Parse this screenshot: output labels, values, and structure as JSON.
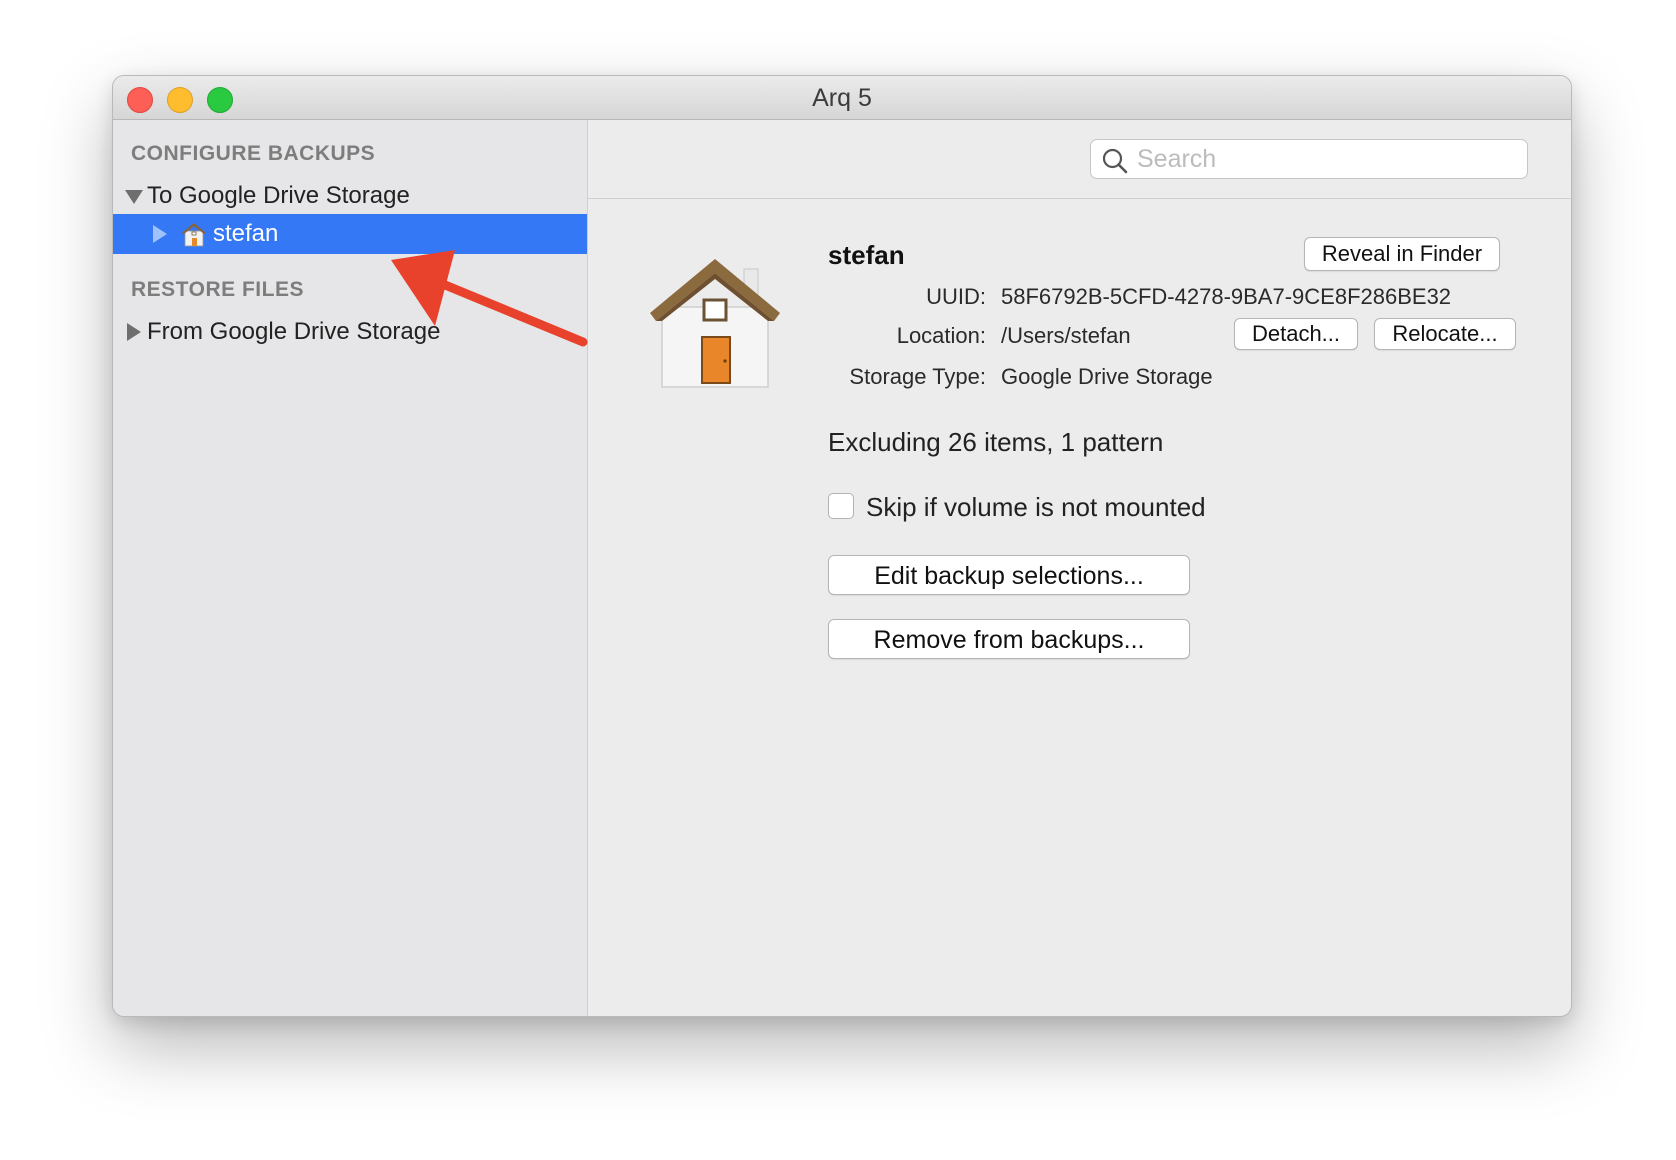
{
  "window": {
    "title": "Arq 5"
  },
  "sidebar": {
    "configure_header": "CONFIGURE BACKUPS",
    "configure_destination": "To Google Drive Storage",
    "selected_item": "stefan",
    "restore_header": "RESTORE FILES",
    "restore_source": "From Google Drive Storage"
  },
  "search": {
    "placeholder": "Search",
    "value": ""
  },
  "detail": {
    "name": "stefan",
    "reveal_button": "Reveal in Finder",
    "uuid_label": "UUID:",
    "uuid_value": "58F6792B-5CFD-4278-9BA7-9CE8F286BE32",
    "location_label": "Location:",
    "location_value": "/Users/stefan",
    "detach_button": "Detach...",
    "relocate_button": "Relocate...",
    "storage_type_label": "Storage Type:",
    "storage_type_value": "Google Drive Storage",
    "excluding": "Excluding 26 items, 1 pattern",
    "skip_checkbox_label": "Skip if volume is not mounted",
    "skip_checked": false,
    "edit_button": "Edit backup selections...",
    "remove_button": "Remove from backups..."
  },
  "colors": {
    "selection": "#3478f6",
    "annotation_arrow": "#e8412c",
    "close": "#fd5e56",
    "minimize": "#fdbd2e",
    "maximize": "#29c940"
  },
  "icons": [
    "close-button",
    "minimize-button",
    "maximize-button",
    "disclosure-triangle",
    "home-folder-icon",
    "search-icon",
    "annotation-arrow"
  ]
}
